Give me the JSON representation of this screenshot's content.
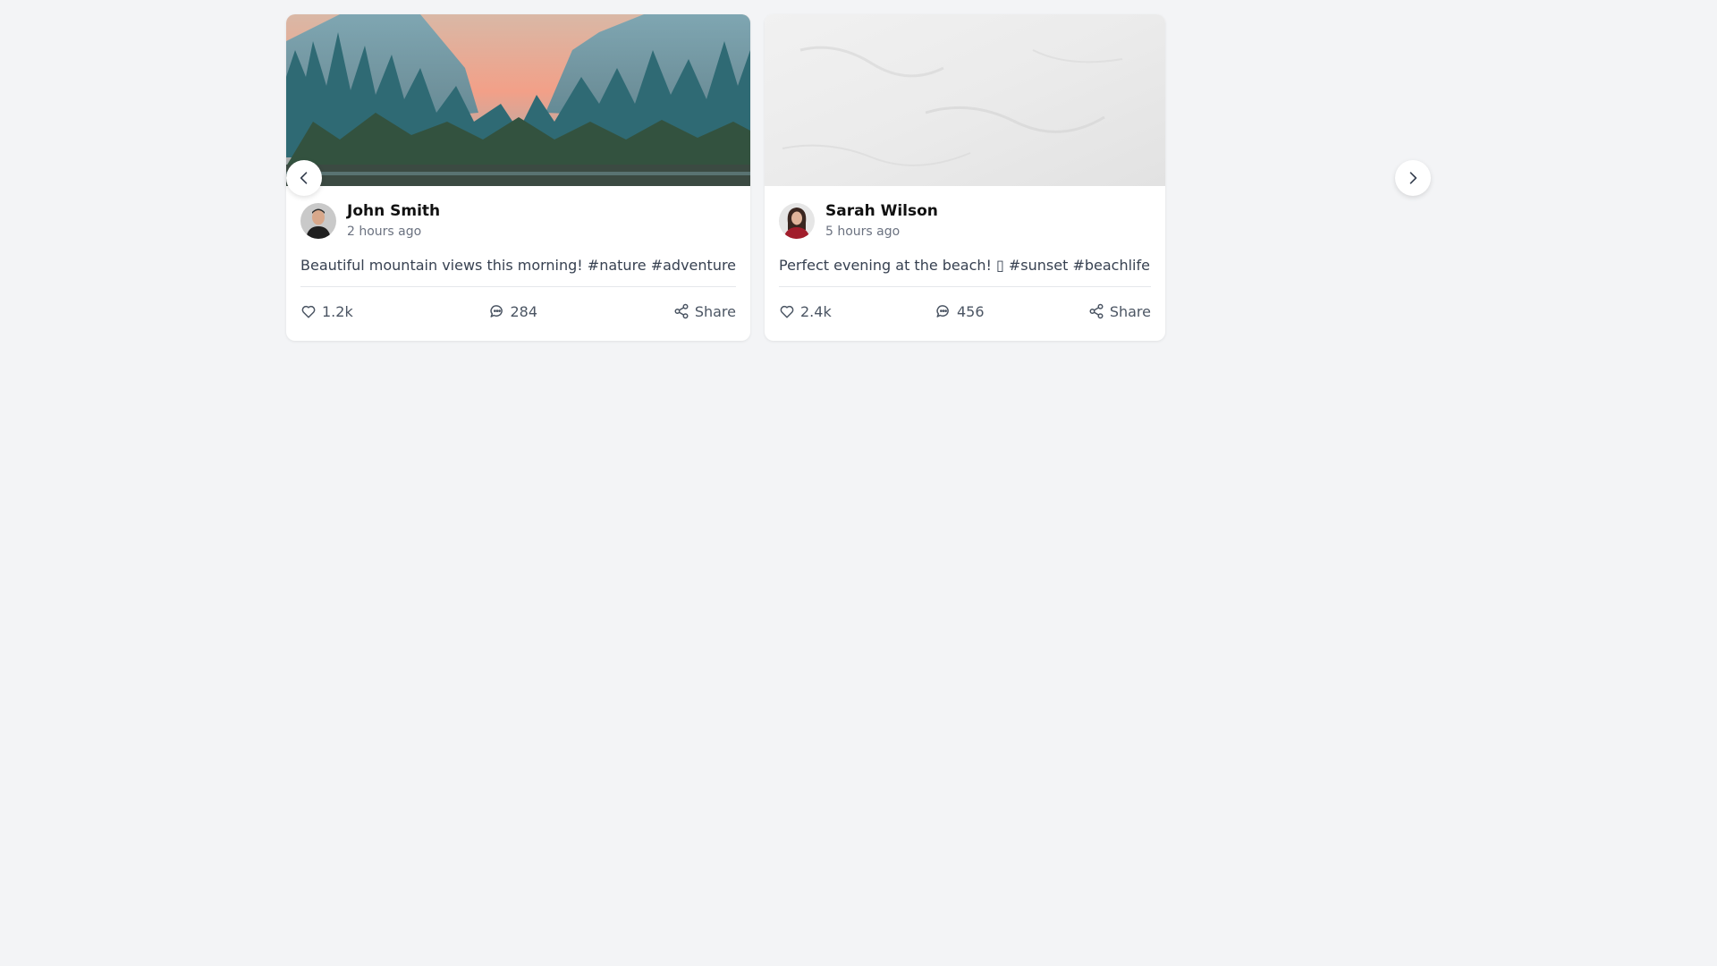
{
  "carousel": {
    "prev_icon": "chevron-left-icon",
    "next_icon": "chevron-right-icon"
  },
  "posts": [
    {
      "author": "John Smith",
      "time": "2 hours ago",
      "text": "Beautiful mountain views this morning! #nature #adventure",
      "likes": "1.2k",
      "comments": "284",
      "share_label": "Share",
      "image": "mountain-forest-photo"
    },
    {
      "author": "Sarah Wilson",
      "time": "5 hours ago",
      "text": "Perfect evening at the beach! ▯ #sunset #beachlife",
      "likes": "2.4k",
      "comments": "456",
      "share_label": "Share",
      "image": "white-sand-texture-photo"
    }
  ],
  "colors": {
    "background": "#f3f4f6",
    "card": "#ffffff",
    "text_primary": "#111111",
    "text_secondary": "#6b7280",
    "text_body": "#374151"
  }
}
